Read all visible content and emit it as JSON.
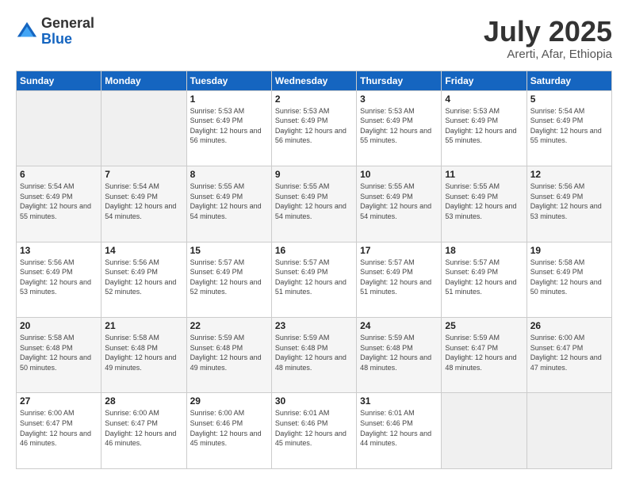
{
  "logo": {
    "general": "General",
    "blue": "Blue"
  },
  "header": {
    "month_year": "July 2025",
    "location": "Arerti, Afar, Ethiopia"
  },
  "weekdays": [
    "Sunday",
    "Monday",
    "Tuesday",
    "Wednesday",
    "Thursday",
    "Friday",
    "Saturday"
  ],
  "weeks": [
    [
      {
        "day": "",
        "info": ""
      },
      {
        "day": "",
        "info": ""
      },
      {
        "day": "1",
        "info": "Sunrise: 5:53 AM\nSunset: 6:49 PM\nDaylight: 12 hours and 56 minutes."
      },
      {
        "day": "2",
        "info": "Sunrise: 5:53 AM\nSunset: 6:49 PM\nDaylight: 12 hours and 56 minutes."
      },
      {
        "day": "3",
        "info": "Sunrise: 5:53 AM\nSunset: 6:49 PM\nDaylight: 12 hours and 55 minutes."
      },
      {
        "day": "4",
        "info": "Sunrise: 5:53 AM\nSunset: 6:49 PM\nDaylight: 12 hours and 55 minutes."
      },
      {
        "day": "5",
        "info": "Sunrise: 5:54 AM\nSunset: 6:49 PM\nDaylight: 12 hours and 55 minutes."
      }
    ],
    [
      {
        "day": "6",
        "info": "Sunrise: 5:54 AM\nSunset: 6:49 PM\nDaylight: 12 hours and 55 minutes."
      },
      {
        "day": "7",
        "info": "Sunrise: 5:54 AM\nSunset: 6:49 PM\nDaylight: 12 hours and 54 minutes."
      },
      {
        "day": "8",
        "info": "Sunrise: 5:55 AM\nSunset: 6:49 PM\nDaylight: 12 hours and 54 minutes."
      },
      {
        "day": "9",
        "info": "Sunrise: 5:55 AM\nSunset: 6:49 PM\nDaylight: 12 hours and 54 minutes."
      },
      {
        "day": "10",
        "info": "Sunrise: 5:55 AM\nSunset: 6:49 PM\nDaylight: 12 hours and 54 minutes."
      },
      {
        "day": "11",
        "info": "Sunrise: 5:55 AM\nSunset: 6:49 PM\nDaylight: 12 hours and 53 minutes."
      },
      {
        "day": "12",
        "info": "Sunrise: 5:56 AM\nSunset: 6:49 PM\nDaylight: 12 hours and 53 minutes."
      }
    ],
    [
      {
        "day": "13",
        "info": "Sunrise: 5:56 AM\nSunset: 6:49 PM\nDaylight: 12 hours and 53 minutes."
      },
      {
        "day": "14",
        "info": "Sunrise: 5:56 AM\nSunset: 6:49 PM\nDaylight: 12 hours and 52 minutes."
      },
      {
        "day": "15",
        "info": "Sunrise: 5:57 AM\nSunset: 6:49 PM\nDaylight: 12 hours and 52 minutes."
      },
      {
        "day": "16",
        "info": "Sunrise: 5:57 AM\nSunset: 6:49 PM\nDaylight: 12 hours and 51 minutes."
      },
      {
        "day": "17",
        "info": "Sunrise: 5:57 AM\nSunset: 6:49 PM\nDaylight: 12 hours and 51 minutes."
      },
      {
        "day": "18",
        "info": "Sunrise: 5:57 AM\nSunset: 6:49 PM\nDaylight: 12 hours and 51 minutes."
      },
      {
        "day": "19",
        "info": "Sunrise: 5:58 AM\nSunset: 6:49 PM\nDaylight: 12 hours and 50 minutes."
      }
    ],
    [
      {
        "day": "20",
        "info": "Sunrise: 5:58 AM\nSunset: 6:48 PM\nDaylight: 12 hours and 50 minutes."
      },
      {
        "day": "21",
        "info": "Sunrise: 5:58 AM\nSunset: 6:48 PM\nDaylight: 12 hours and 49 minutes."
      },
      {
        "day": "22",
        "info": "Sunrise: 5:59 AM\nSunset: 6:48 PM\nDaylight: 12 hours and 49 minutes."
      },
      {
        "day": "23",
        "info": "Sunrise: 5:59 AM\nSunset: 6:48 PM\nDaylight: 12 hours and 48 minutes."
      },
      {
        "day": "24",
        "info": "Sunrise: 5:59 AM\nSunset: 6:48 PM\nDaylight: 12 hours and 48 minutes."
      },
      {
        "day": "25",
        "info": "Sunrise: 5:59 AM\nSunset: 6:47 PM\nDaylight: 12 hours and 48 minutes."
      },
      {
        "day": "26",
        "info": "Sunrise: 6:00 AM\nSunset: 6:47 PM\nDaylight: 12 hours and 47 minutes."
      }
    ],
    [
      {
        "day": "27",
        "info": "Sunrise: 6:00 AM\nSunset: 6:47 PM\nDaylight: 12 hours and 46 minutes."
      },
      {
        "day": "28",
        "info": "Sunrise: 6:00 AM\nSunset: 6:47 PM\nDaylight: 12 hours and 46 minutes."
      },
      {
        "day": "29",
        "info": "Sunrise: 6:00 AM\nSunset: 6:46 PM\nDaylight: 12 hours and 45 minutes."
      },
      {
        "day": "30",
        "info": "Sunrise: 6:01 AM\nSunset: 6:46 PM\nDaylight: 12 hours and 45 minutes."
      },
      {
        "day": "31",
        "info": "Sunrise: 6:01 AM\nSunset: 6:46 PM\nDaylight: 12 hours and 44 minutes."
      },
      {
        "day": "",
        "info": ""
      },
      {
        "day": "",
        "info": ""
      }
    ]
  ]
}
